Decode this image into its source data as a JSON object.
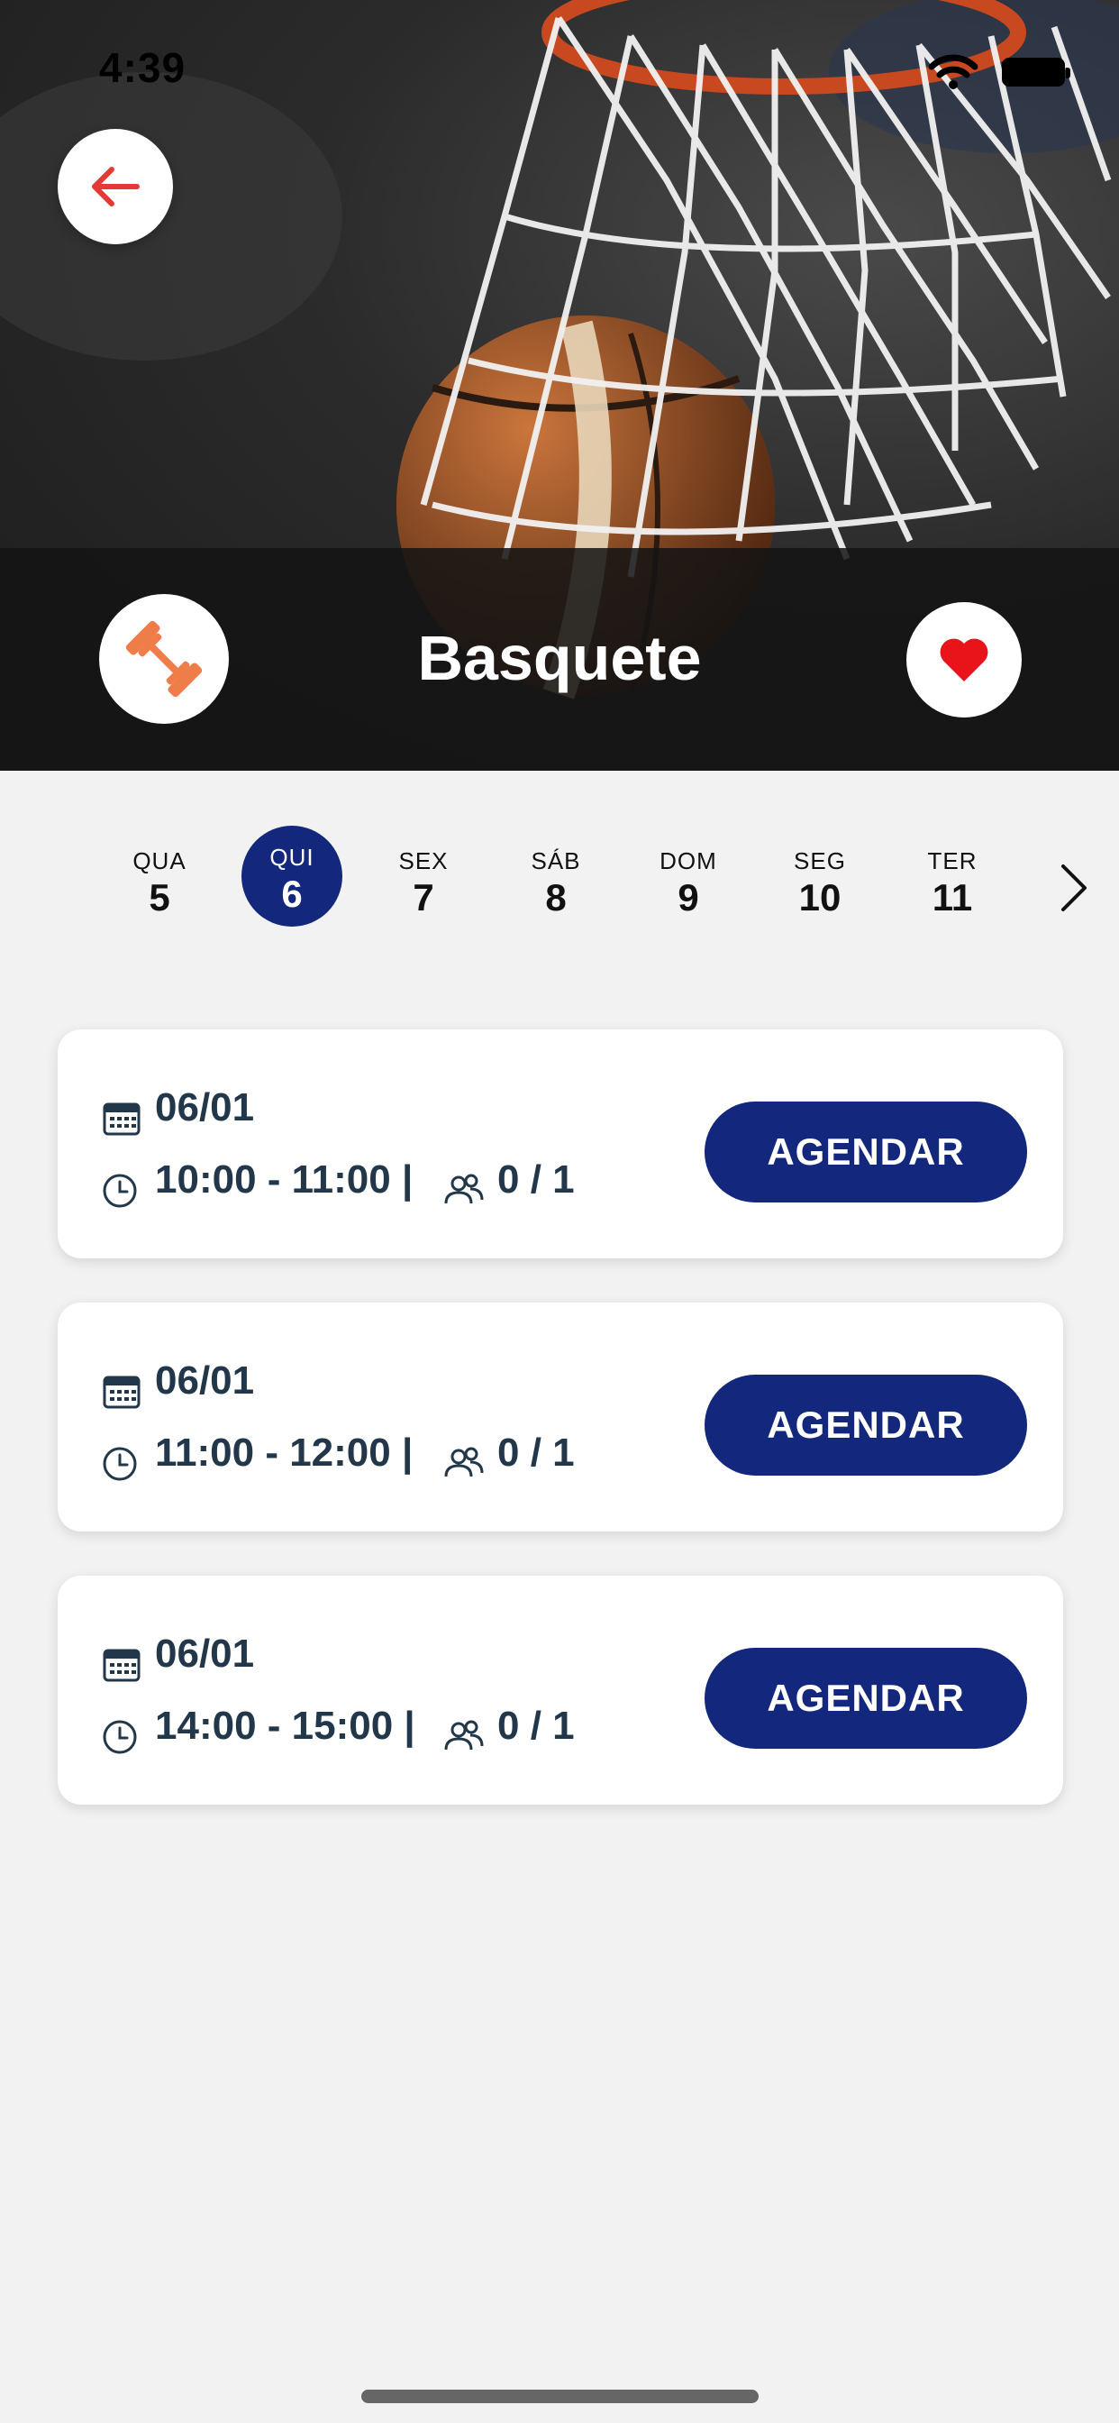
{
  "status_bar": {
    "time": "4:39"
  },
  "header": {
    "title": "Basquete",
    "back_icon": "arrow-left-icon",
    "activity_icon": "dumbbell-icon",
    "favorite_icon": "heart-icon",
    "accent_color": "#e53935",
    "activity_color": "#ef7d4a"
  },
  "days": [
    {
      "dow": "QUA",
      "num": "5",
      "selected": false
    },
    {
      "dow": "QUI",
      "num": "6",
      "selected": true
    },
    {
      "dow": "SEX",
      "num": "7",
      "selected": false
    },
    {
      "dow": "SÁB",
      "num": "8",
      "selected": false
    },
    {
      "dow": "DOM",
      "num": "9",
      "selected": false
    },
    {
      "dow": "SEG",
      "num": "10",
      "selected": false
    },
    {
      "dow": "TER",
      "num": "11",
      "selected": false
    }
  ],
  "slots": [
    {
      "date": "06/01",
      "time": "10:00 - 11:00 |",
      "capacity": "0 / 1",
      "button": "AGENDAR"
    },
    {
      "date": "06/01",
      "time": "11:00 - 12:00 |",
      "capacity": "0 / 1",
      "button": "AGENDAR"
    },
    {
      "date": "06/01",
      "time": "14:00 - 15:00 |",
      "capacity": "0 / 1",
      "button": "AGENDAR"
    }
  ],
  "colors": {
    "primary": "#13287c",
    "text": "#22374a",
    "background": "#f2f2f2"
  }
}
